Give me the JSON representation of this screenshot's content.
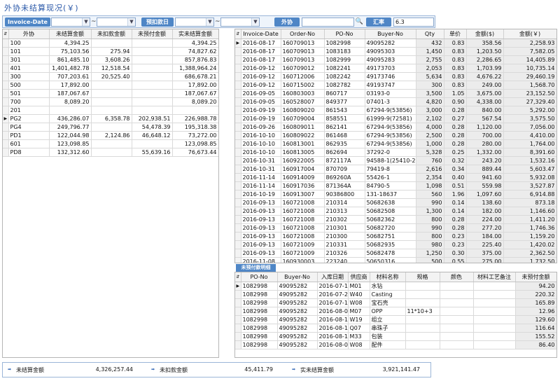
{
  "title": "外协未结算现况(￥)",
  "filter": {
    "invoice_date_label": "Invoice-Date",
    "tilde": "~",
    "date_label2": "预扣款日",
    "vendor_label": "外协",
    "rate_label": "汇率",
    "rate_value": "6.3"
  },
  "left_grid": {
    "headers": [
      "外协",
      "未结算金额",
      "未扣款金额",
      "未预付金额",
      "实未结算金额"
    ],
    "current_row": 9,
    "rows": [
      [
        "100",
        "4,394.25",
        "",
        "",
        "4,394.25"
      ],
      [
        "101",
        "75,103.56",
        "275.94",
        "",
        "74,827.62"
      ],
      [
        "301",
        "861,485.10",
        "3,608.26",
        "",
        "857,876.83"
      ],
      [
        "401",
        "1,401,482.78",
        "12,518.54",
        "",
        "1,388,964.24"
      ],
      [
        "300",
        "707,203.61",
        "20,525.40",
        "",
        "686,678.21"
      ],
      [
        "500",
        "17,892.00",
        "",
        "",
        "17,892.00"
      ],
      [
        "501",
        "187,067.67",
        "",
        "",
        "187,067.67"
      ],
      [
        "700",
        "8,089.20",
        "",
        "",
        "8,089.20"
      ],
      [
        "201",
        "",
        "",
        "",
        ""
      ],
      [
        "PG2",
        "436,286.07",
        "6,358.78",
        "202,938.51",
        "226,988.78"
      ],
      [
        "PG4",
        "249,796.77",
        "",
        "54,478.39",
        "195,318.38"
      ],
      [
        "PD1",
        "122,044.98",
        "2,124.86",
        "46,648.12",
        "73,272.00"
      ],
      [
        "601",
        "123,098.85",
        "",
        "",
        "123,098.85"
      ],
      [
        "PD8",
        "132,312.60",
        "",
        "55,639.16",
        "76,673.44"
      ]
    ]
  },
  "right_grid": {
    "headers": [
      "Invoice-Date",
      "Order-No",
      "PO-No",
      "Buyer-No",
      "Qty",
      "单价",
      "金额($)",
      "金额(￥)"
    ],
    "current_row": 0,
    "rows": [
      [
        "2016-08-17",
        "160709013",
        "1082998",
        "49095282",
        "432",
        "0.83",
        "358.56",
        "2,258.93"
      ],
      [
        "2016-08-17",
        "160709013",
        "1083183",
        "49095303",
        "1,450",
        "0.83",
        "1,203.50",
        "7,582.05"
      ],
      [
        "2016-08-17",
        "160709013",
        "1082999",
        "49095283",
        "2,755",
        "0.83",
        "2,286.65",
        "14,405.89"
      ],
      [
        "2016-09-12",
        "160709012",
        "1082241",
        "49173703",
        "2,053",
        "0.83",
        "1,703.99",
        "10,735.14"
      ],
      [
        "2016-09-12",
        "160712006",
        "1082242",
        "49173746",
        "5,634",
        "0.83",
        "4,676.22",
        "29,460.19"
      ],
      [
        "2016-09-12",
        "160715002",
        "1082782",
        "49193747",
        "300",
        "0.83",
        "249.00",
        "1,568.70"
      ],
      [
        "2016-09-05",
        "160803003",
        "860717",
        "03193-0",
        "3,500",
        "1.05",
        "3,675.00",
        "23,152.50"
      ],
      [
        "2016-09-05",
        "160528007",
        "849377",
        "07401-3",
        "4,820",
        "0.90",
        "4,338.00",
        "27,329.40"
      ],
      [
        "2016-09-19",
        "160809020",
        "861543",
        "67294-9(53856)",
        "3,000",
        "0.28",
        "840.00",
        "5,292.00"
      ],
      [
        "2016-09-19",
        "160709004",
        "858551",
        "61999-9(72581)",
        "2,102",
        "0.27",
        "567.54",
        "3,575.50"
      ],
      [
        "2016-09-26",
        "160809011",
        "862141",
        "67294-9(53856)",
        "4,000",
        "0.28",
        "1,120.00",
        "7,056.00"
      ],
      [
        "2016-10-10",
        "160809022",
        "861468",
        "67294-9(53856)",
        "2,500",
        "0.28",
        "700.00",
        "4,410.00"
      ],
      [
        "2016-10-10",
        "160813001",
        "862935",
        "67294-9(53856)",
        "1,000",
        "0.28",
        "280.00",
        "1,764.00"
      ],
      [
        "2016-10-10",
        "160813005",
        "862694",
        "37292-0",
        "5,328",
        "0.25",
        "1,332.00",
        "8,391.60"
      ],
      [
        "2016-10-31",
        "160922005",
        "872117A",
        "94588-1(25410-2",
        "760",
        "0.32",
        "243.20",
        "1,532.16"
      ],
      [
        "2016-10-31",
        "160917004",
        "870709",
        "79419-8",
        "2,616",
        "0.34",
        "889.44",
        "5,603.47"
      ],
      [
        "2016-11-14",
        "160914009",
        "869260A",
        "55426-1",
        "2,354",
        "0.40",
        "941.60",
        "5,932.08"
      ],
      [
        "2016-11-14",
        "160917036",
        "871364A",
        "84790-5",
        "1,098",
        "0.51",
        "559.98",
        "3,527.87"
      ],
      [
        "2016-10-19",
        "160913007",
        "90386800",
        "131-18637",
        "560",
        "1.96",
        "1,097.60",
        "6,914.88"
      ],
      [
        "2016-09-13",
        "160721008",
        "210314",
        "50682638",
        "990",
        "0.14",
        "138.60",
        "873.18"
      ],
      [
        "2016-09-13",
        "160721008",
        "210313",
        "50682508",
        "1,300",
        "0.14",
        "182.00",
        "1,146.60"
      ],
      [
        "2016-09-13",
        "160721008",
        "210302",
        "50682362",
        "800",
        "0.28",
        "224.00",
        "1,411.20"
      ],
      [
        "2016-09-13",
        "160721008",
        "210301",
        "50682720",
        "990",
        "0.28",
        "277.20",
        "1,746.36"
      ],
      [
        "2016-09-13",
        "160721008",
        "210300",
        "50682751",
        "800",
        "0.23",
        "184.00",
        "1,159.20"
      ],
      [
        "2016-09-13",
        "160721009",
        "210331",
        "50682935",
        "980",
        "0.23",
        "225.40",
        "1,420.02"
      ],
      [
        "2016-09-13",
        "160721009",
        "210326",
        "50682478",
        "1,250",
        "0.30",
        "375.00",
        "2,362.50"
      ],
      [
        "2016-11-08",
        "160930003",
        "223240",
        "50650316",
        "500",
        "0.55",
        "275.00",
        "1,732.50"
      ]
    ]
  },
  "sub_grid": {
    "title": "未预付款明细",
    "headers": [
      "PO-No",
      "Buyer-No",
      "入库日期",
      "供应商",
      "材料名称",
      "规格",
      "颜色",
      "材料工艺备注",
      "未预付金额"
    ],
    "current_row": 0,
    "rows": [
      [
        "1082998",
        "49095282",
        "2016-07-14",
        "M01",
        "水钻",
        "",
        "",
        "",
        "94.20"
      ],
      [
        "1082998",
        "49095282",
        "2016-07-27",
        "W40",
        "Casting",
        "",
        "",
        "",
        "220.32"
      ],
      [
        "1082998",
        "49095282",
        "2016-07-14",
        "W08",
        "宝石壳",
        "",
        "",
        "",
        "165.89"
      ],
      [
        "1082998",
        "49095282",
        "2016-08-05",
        "M07",
        "OPP",
        "11*10+3",
        "",
        "",
        "12.96"
      ],
      [
        "1082998",
        "49095282",
        "2016-08-15",
        "W19",
        "组立",
        "",
        "",
        "",
        "129.60"
      ],
      [
        "1082998",
        "49095282",
        "2016-08-15",
        "Q07",
        "串珠子",
        "",
        "",
        "",
        "116.64"
      ],
      [
        "1082998",
        "49095282",
        "2016-08-15",
        "M33",
        "包装",
        "",
        "",
        "",
        "155.52"
      ],
      [
        "1082998",
        "49095282",
        "2016-08-05",
        "W08",
        "配件",
        "",
        "",
        "",
        "86.40"
      ]
    ]
  },
  "totals": {
    "unsettled_label": "未结算金额",
    "unsettled_value": "4,326,257.44",
    "undeducted_label": "未扣款金额",
    "undeducted_value": "45,411.79",
    "actual_label": "实未结算金额",
    "actual_value": "3,921,141.47"
  }
}
